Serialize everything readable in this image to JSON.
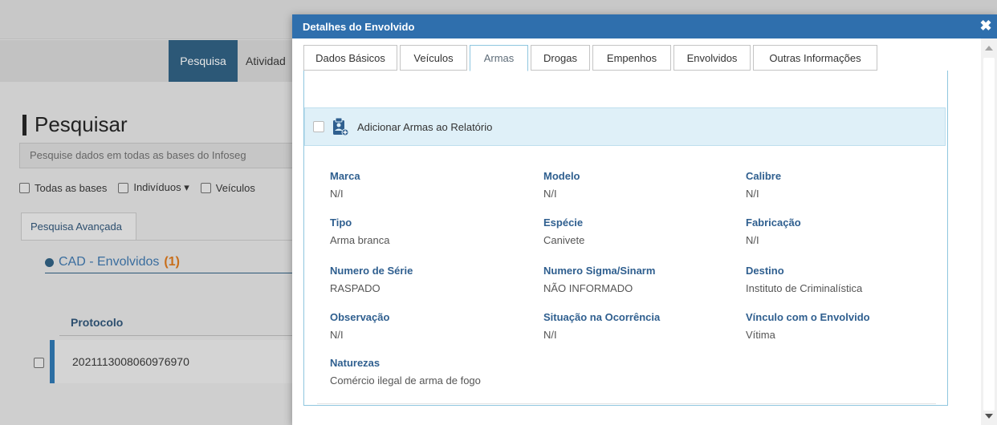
{
  "background": {
    "nav": {
      "active": "Pesquisa",
      "next": "Atividad"
    },
    "title": "Pesquisar",
    "search_placeholder": "Pesquise dados em todas as bases do Infoseg",
    "filters": [
      {
        "label": "Todas as bases"
      },
      {
        "label": "Indivíduos ▾"
      },
      {
        "label": "Veículos"
      }
    ],
    "advanced_tab": "Pesquisa Avançada",
    "cad_label": "CAD - Envolvidos",
    "cad_count": "(1)",
    "column_protocolo": "Protocolo",
    "row_protocolo": "2021113008060976970"
  },
  "modal": {
    "title": "Detalhes do Envolvido",
    "close_glyph": "✖",
    "tabs": [
      {
        "label": "Dados Básicos",
        "active": false
      },
      {
        "label": "Veículos",
        "active": false
      },
      {
        "label": "Armas",
        "active": true
      },
      {
        "label": "Drogas",
        "active": false
      },
      {
        "label": "Empenhos",
        "active": false
      },
      {
        "label": "Envolvidos",
        "active": false
      },
      {
        "label": "Outras Informações",
        "active": false
      }
    ],
    "add_label": "Adicionar Armas ao Relatório",
    "add_icon": "clipboard-add-icon",
    "fields": [
      {
        "label": "Marca",
        "value": "N/I"
      },
      {
        "label": "Modelo",
        "value": "N/I"
      },
      {
        "label": "Calibre",
        "value": "N/I"
      },
      {
        "label": "Tipo",
        "value": "Arma branca"
      },
      {
        "label": "Espécie",
        "value": "Canivete"
      },
      {
        "label": "Fabricação",
        "value": "N/I"
      },
      {
        "label": "Numero de Série",
        "value": "RASPADO"
      },
      {
        "label": "Numero Sigma/Sinarm",
        "value": "NÃO INFORMADO"
      },
      {
        "label": "Destino",
        "value": "Instituto de Criminalística"
      },
      {
        "label": "Observação",
        "value": "N/I"
      },
      {
        "label": "Situação na Ocorrência",
        "value": "N/I"
      },
      {
        "label": "Vínculo com o Envolvido",
        "value": "Vítima"
      },
      {
        "label": "Naturezas",
        "value": "Comércio ilegal de arma de fogo"
      }
    ]
  },
  "colors": {
    "header_blue": "#2f6fad",
    "label_blue": "#2f5f8f",
    "info_bg": "#dff0f8",
    "nav_active": "#2c5877",
    "cad_count": "#c86e1a"
  }
}
